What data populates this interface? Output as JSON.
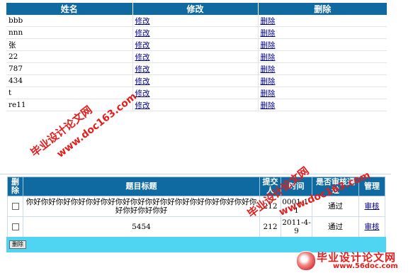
{
  "user_table": {
    "headers": [
      "姓名",
      "修改",
      "删除"
    ],
    "rows": [
      {
        "name": "bbb",
        "edit": "修改",
        "delete": "删除"
      },
      {
        "name": "nnn",
        "edit": "修改",
        "delete": "删除"
      },
      {
        "name": "张",
        "edit": "修改",
        "delete": "删除"
      },
      {
        "name": "22",
        "edit": "修改",
        "delete": "删除"
      },
      {
        "name": "787",
        "edit": "修改",
        "delete": "删除"
      },
      {
        "name": "434",
        "edit": "修改",
        "delete": "删除"
      },
      {
        "name": "t",
        "edit": "修改",
        "delete": "删除"
      },
      {
        "name": "re11",
        "edit": "修改",
        "delete": "删除"
      }
    ]
  },
  "topic_table": {
    "headers": {
      "delete": "删除",
      "title": "题目标题",
      "submitter": "提交人",
      "time": "时间",
      "approved": "是否审核通过",
      "manage": "管理"
    },
    "rows": [
      {
        "title": "你好你好你好你好你好你好你好你好你好你好你好你好你好你好你好你好你好你好你好",
        "submitter": "212",
        "time": "0001-1-1",
        "approved": "通过",
        "action": "审核"
      },
      {
        "title": "5454",
        "submitter": "212",
        "time": "2011-4-9",
        "approved": "通过",
        "action": "审核"
      }
    ]
  },
  "delete_button_label": "删除",
  "watermarks": {
    "site_name": "毕业设计论文网",
    "url": "www.doc163.com",
    "logo_title": "毕业设计论文网",
    "logo_url": "www.56doc.com",
    "color": "#e41d1d"
  },
  "colors": {
    "header_bg": "#0e6aa0",
    "bottom_bar": "#4fd5f1",
    "link": "#000080"
  }
}
